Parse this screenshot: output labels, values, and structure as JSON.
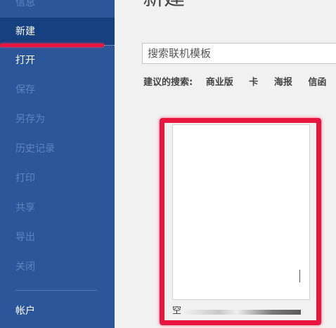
{
  "sidebar": {
    "items": [
      {
        "label": "信息",
        "state": "disabled"
      },
      {
        "label": "新建",
        "state": "selected"
      },
      {
        "label": "打开",
        "state": "enabled"
      },
      {
        "label": "保存",
        "state": "disabled"
      },
      {
        "label": "另存为",
        "state": "disabled"
      },
      {
        "label": "历史记录",
        "state": "disabled"
      },
      {
        "label": "打印",
        "state": "disabled"
      },
      {
        "label": "共享",
        "state": "disabled"
      },
      {
        "label": "导出",
        "state": "disabled"
      },
      {
        "label": "关闭",
        "state": "disabled"
      },
      {
        "label": "帐户",
        "state": "enabled"
      }
    ]
  },
  "main": {
    "title": "新建",
    "search_placeholder": "搜索联机模板",
    "suggested": {
      "label": "建议的搜索:",
      "items": [
        "商业版",
        "卡",
        "海报",
        "信函"
      ]
    },
    "template": {
      "caption": "空"
    }
  },
  "colors": {
    "sidebar_bg": "#2b579a",
    "highlight_red": "#e8163f",
    "selected_bg": "#16407f"
  }
}
